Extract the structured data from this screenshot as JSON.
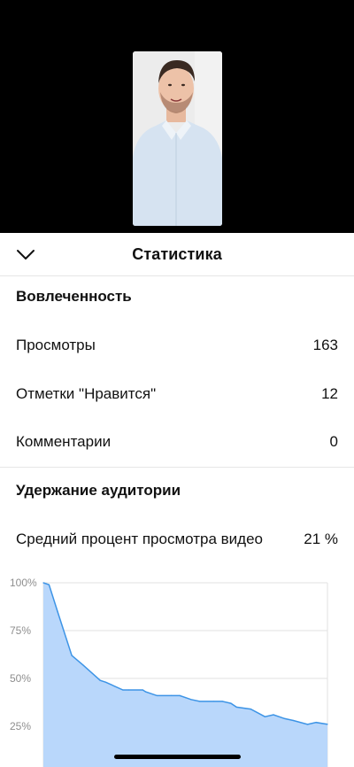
{
  "header": {
    "title": "Статистика",
    "collapse_icon": "chevron-down-icon"
  },
  "engagement": {
    "title": "Вовлеченность",
    "rows": [
      {
        "label": "Просмотры",
        "value": "163"
      },
      {
        "label": "Отметки \"Нравится\"",
        "value": "12"
      },
      {
        "label": "Комментарии",
        "value": "0"
      }
    ]
  },
  "retention": {
    "title": "Удержание аудитории",
    "avg_label": "Средний процент просмотра видео",
    "avg_value": "21 %"
  },
  "chart_data": {
    "type": "area",
    "title": "",
    "xlabel": "",
    "ylabel": "",
    "y_ticks": [
      "100%",
      "75%",
      "50%",
      "25%"
    ],
    "ylim": [
      0,
      100
    ],
    "x": [
      0,
      0.02,
      0.05,
      0.1,
      0.14,
      0.2,
      0.22,
      0.28,
      0.3,
      0.35,
      0.36,
      0.4,
      0.45,
      0.48,
      0.5,
      0.52,
      0.55,
      0.6,
      0.63,
      0.66,
      0.68,
      0.73,
      0.78,
      0.81,
      0.85,
      0.88,
      0.93,
      0.96,
      1.0
    ],
    "values": [
      100,
      99,
      85,
      62,
      57,
      49,
      48,
      44,
      44,
      44,
      43,
      41,
      41,
      41,
      40,
      39,
      38,
      38,
      38,
      37,
      35,
      34,
      30,
      31,
      29,
      28,
      26,
      27,
      26
    ],
    "colors": {
      "fill": "#b9d7fb",
      "line": "#3d94e6",
      "grid": "#e2e2e2"
    }
  }
}
